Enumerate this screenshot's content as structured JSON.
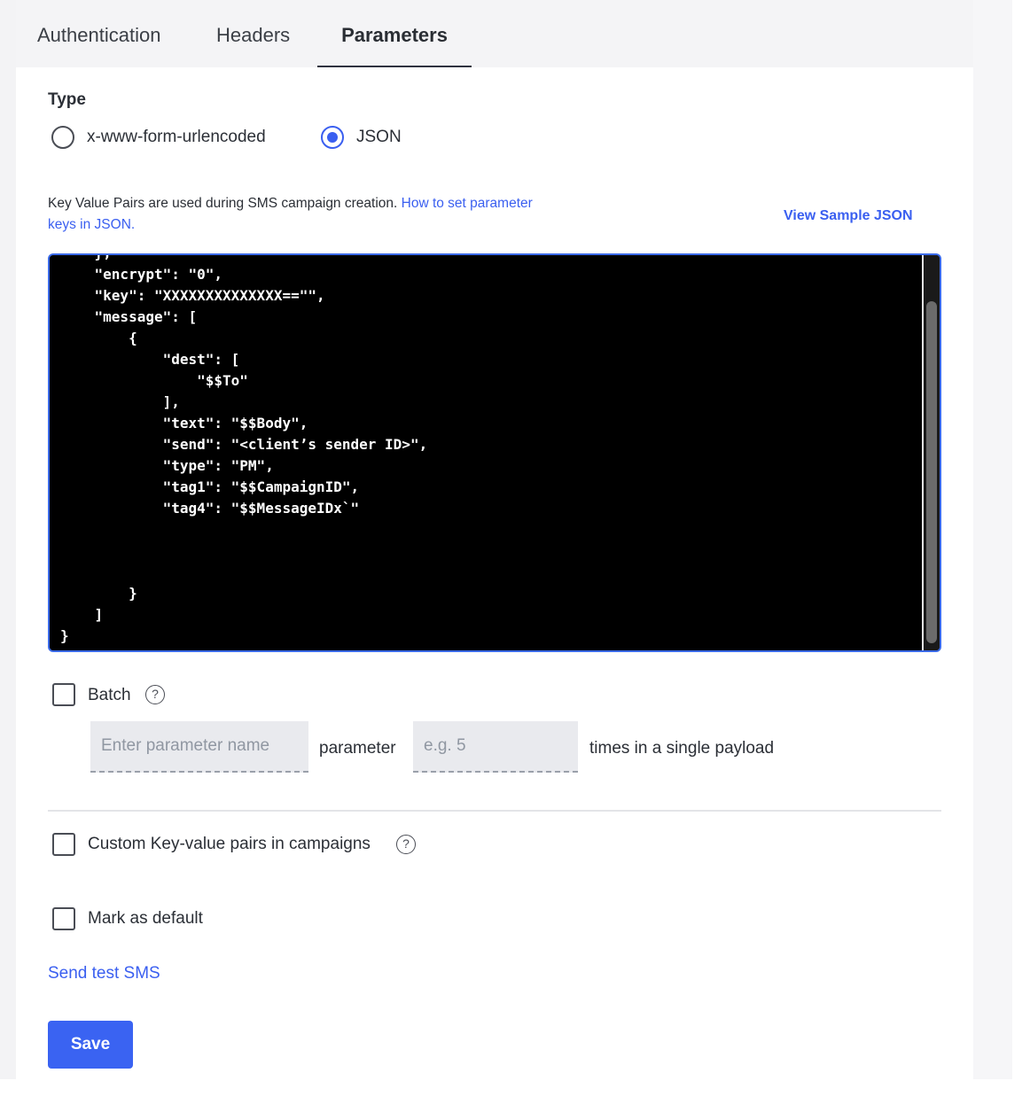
{
  "tabs": [
    {
      "label": "Authentication",
      "active": false
    },
    {
      "label": "Headers",
      "active": false
    },
    {
      "label": "Parameters",
      "active": true
    }
  ],
  "type_section": {
    "label": "Type",
    "options": [
      {
        "label": "x-www-form-urlencoded",
        "selected": false
      },
      {
        "label": "JSON",
        "selected": true
      }
    ]
  },
  "help": {
    "text": "Key Value Pairs are used during SMS campaign creation.",
    "link": "How to set parameter keys in JSON."
  },
  "view_sample_label": "View Sample JSON",
  "editor": {
    "code": "    },\n    \"encrypt\": \"0\",\n    \"key\": \"XXXXXXXXXXXXXX==\"\",\n    \"message\": [\n        {\n            \"dest\": [\n                \"$$To\"\n            ],\n            \"text\": \"$$Body\",\n            \"send\": \"<client’s sender ID>\",\n            \"type\": \"PM\",\n            \"tag1\": \"$$CampaignID\",\n            \"tag4\": \"$$MessageIDx`\"\n\n\n\n        }\n    ]\n}"
  },
  "batch": {
    "label": "Batch",
    "checked": false,
    "help_icon": "question-circle-icon",
    "param_placeholder": "Enter parameter name",
    "param_text": "parameter",
    "count_placeholder": "e.g. 5",
    "suffix_text": "times in a single payload"
  },
  "custom_kv": {
    "label": "Custom Key-value pairs in campaigns",
    "checked": false,
    "help_icon": "question-circle-icon"
  },
  "mark_default": {
    "label": "Mark as default",
    "checked": false
  },
  "send_test_label": "Send test SMS",
  "save_label": "Save",
  "colors": {
    "accent": "#3a5ff0",
    "editor_bg": "#000000",
    "save_button": "#3a63f2"
  }
}
